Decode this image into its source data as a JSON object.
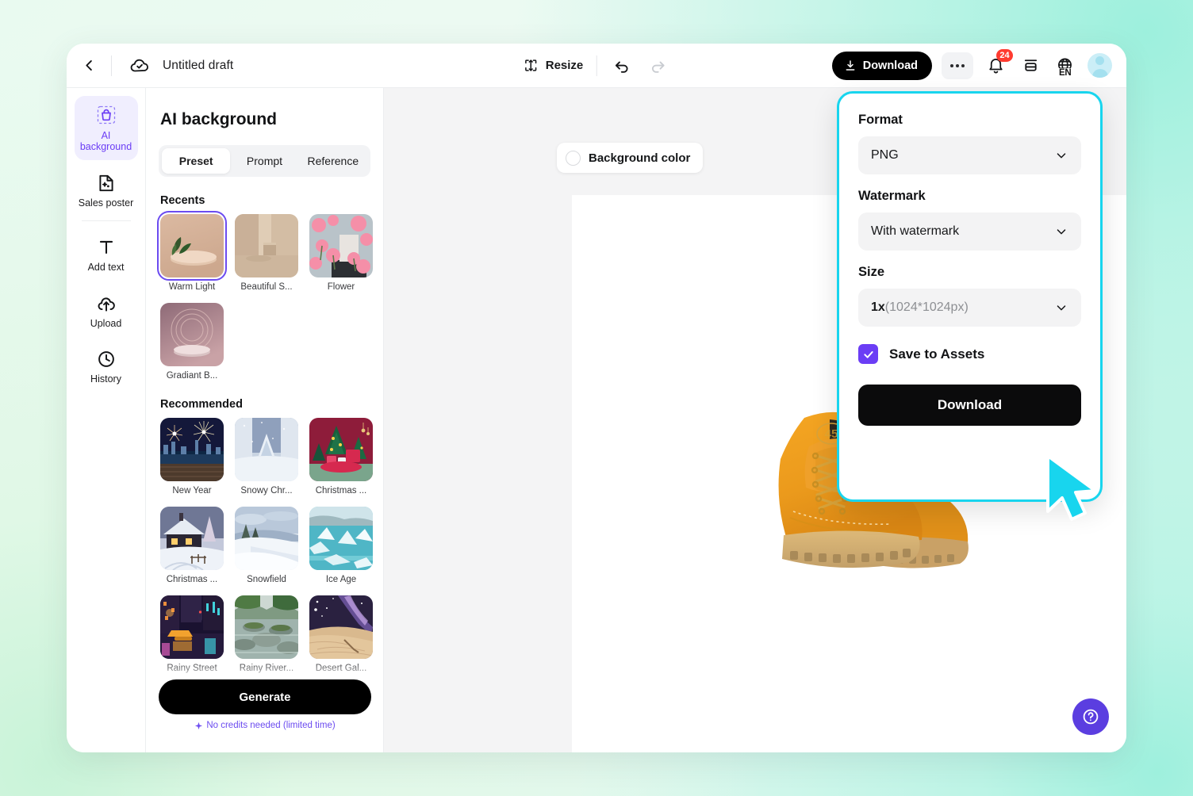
{
  "topbar": {
    "back_icon": "chevron-left-icon",
    "cloud_icon": "cloud-saved-icon",
    "doc_title": "Untitled draft",
    "resize_label": "Resize",
    "undo_icon": "undo-icon",
    "redo_icon": "redo-icon",
    "download_label": "Download",
    "more_icon": "ellipsis-icon",
    "notification_icon": "bell-icon",
    "notification_count": "24",
    "layers_icon": "layers-icon",
    "language_icon": "globe-icon",
    "language_code": "EN",
    "avatar_icon": "avatar-icon"
  },
  "rail": {
    "items": [
      {
        "label": "AI background",
        "icon": "ai-bag-icon",
        "active": true
      },
      {
        "label": "Sales poster",
        "icon": "sales-poster-icon",
        "active": false
      },
      {
        "label": "Add text",
        "icon": "text-t-icon",
        "active": false
      },
      {
        "label": "Upload",
        "icon": "upload-cloud-icon",
        "active": false
      },
      {
        "label": "History",
        "icon": "clock-icon",
        "active": false
      }
    ]
  },
  "panel": {
    "title": "AI background",
    "tabs": [
      {
        "label": "Preset",
        "active": true
      },
      {
        "label": "Prompt",
        "active": false
      },
      {
        "label": "Reference",
        "active": false
      }
    ],
    "recents_title": "Recents",
    "recents": [
      {
        "label": "Warm Light",
        "selected": true
      },
      {
        "label": "Beautiful S...",
        "selected": false
      },
      {
        "label": "Flower",
        "selected": false
      },
      {
        "label": "Gradiant B...",
        "selected": false
      }
    ],
    "recommended_title": "Recommended",
    "recommended": [
      {
        "label": "New Year"
      },
      {
        "label": "Snowy Chr..."
      },
      {
        "label": "Christmas ..."
      },
      {
        "label": "Christmas ..."
      },
      {
        "label": "Snowfield"
      },
      {
        "label": "Ice Age"
      },
      {
        "label": "Rainy Street"
      },
      {
        "label": "Rainy River..."
      },
      {
        "label": "Desert Gal..."
      }
    ],
    "generate_label": "Generate",
    "credits_note": "No credits needed (limited time)"
  },
  "canvas": {
    "background_color_label": "Background color",
    "background_color_swatch": "#ffffff",
    "artboard_color": "#ffffff",
    "product_image": "timberland-boots"
  },
  "download_popover": {
    "format_label": "Format",
    "format_value": "PNG",
    "watermark_label": "Watermark",
    "watermark_value": "With watermark",
    "size_label": "Size",
    "size_multiplier": "1x",
    "size_dimensions": "(1024*1024px)",
    "save_to_assets_label": "Save to Assets",
    "save_to_assets_checked": true,
    "download_label": "Download",
    "highlight_color": "#18d5ee",
    "accent_color": "#6b3df5"
  },
  "help": {
    "icon": "question-circle-icon"
  }
}
